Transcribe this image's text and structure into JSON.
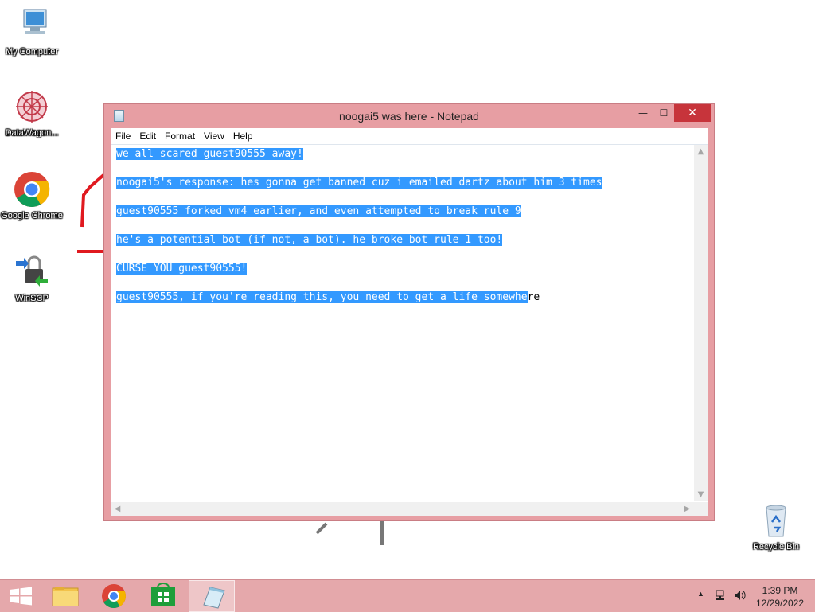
{
  "desktop": {
    "icons": [
      {
        "label": "My Computer",
        "icon": "computer-icon"
      },
      {
        "label": "DataWagon...",
        "icon": "datawagon-icon"
      },
      {
        "label": "Google Chrome",
        "icon": "chrome-icon"
      },
      {
        "label": "WinSCP",
        "icon": "winscp-icon"
      },
      {
        "label": "Recycle Bin",
        "icon": "recycle-bin-icon"
      }
    ]
  },
  "window": {
    "title": "noogai5 was here - Notepad",
    "minimize": "—",
    "maximize": "☐",
    "close": "✕",
    "menu": [
      "File",
      "Edit",
      "Format",
      "View",
      "Help"
    ],
    "lines": [
      {
        "selected": "we all scared guest90555 away!",
        "rest": ""
      },
      {
        "selected": "noogai5's response: hes gonna get banned cuz i emailed dartz about him 3 times",
        "rest": ""
      },
      {
        "selected": "guest90555 forked vm4 earlier, and even attempted to break rule 9",
        "rest": ""
      },
      {
        "selected": "he's a potential bot (if not, a bot). he broke bot rule 1 too!",
        "rest": ""
      },
      {
        "selected": "CURSE YOU guest90555!",
        "rest": ""
      },
      {
        "selected": "guest90555, if you're reading this, you need to get a life somewhe",
        "rest": "re"
      }
    ]
  },
  "taskbar": {
    "apps": [
      {
        "name": "start",
        "icon": "windows-start-icon"
      },
      {
        "name": "file-explorer",
        "icon": "folder-icon"
      },
      {
        "name": "chrome",
        "icon": "chrome-icon"
      },
      {
        "name": "store",
        "icon": "store-icon"
      },
      {
        "name": "notepad",
        "icon": "notepad-icon"
      }
    ],
    "clock_time": "1:39 PM",
    "clock_date": "12/29/2022"
  },
  "colors": {
    "window_frame": "#e79ea3",
    "selection": "#3399ff",
    "close_button": "#c7343b",
    "taskbar": "#e5a8ab"
  }
}
